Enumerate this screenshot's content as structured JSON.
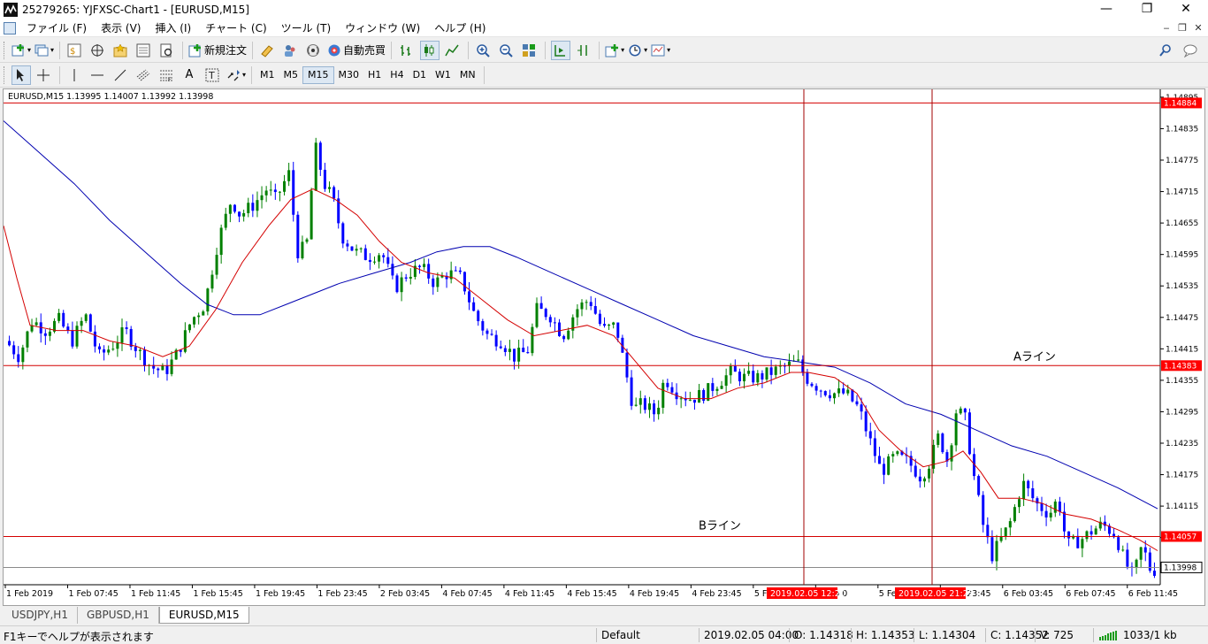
{
  "window": {
    "title": "25279265: YJFXSC-Chart1 - [EURUSD,M15]",
    "controls": [
      "—",
      "❐",
      "✕"
    ]
  },
  "menu": {
    "items": [
      "ファイル (F)",
      "表示 (V)",
      "挿入 (I)",
      "チャート (C)",
      "ツール (T)",
      "ウィンドウ (W)",
      "ヘルプ (H)"
    ]
  },
  "toolbar": {
    "new_order_label": "新規注文",
    "auto_trade_label": "自動売買"
  },
  "timeframes": [
    "M1",
    "M5",
    "M15",
    "M30",
    "H1",
    "H4",
    "D1",
    "W1",
    "MN"
  ],
  "active_timeframe": "M15",
  "tabs": [
    {
      "label": "USDJPY,H1",
      "active": false
    },
    {
      "label": "GBPUSD,H1",
      "active": false
    },
    {
      "label": "EURUSD,M15",
      "active": true
    }
  ],
  "status": {
    "help": "F1キーでヘルプが表示されます",
    "profile": "Default",
    "datetime": "2019.02.05 04:00",
    "open": "O: 1.14318",
    "high": "H: 1.14353",
    "low": "L: 1.14304",
    "close": "C: 1.14352",
    "volume": "V: 725",
    "traffic": "1033/1 kb"
  },
  "colors": {
    "bull": "#008000",
    "bear": "#0000ff",
    "ma_fast": "#d40000",
    "ma_slow": "#0000b0",
    "hline": "#d40000",
    "vline": "#a00000",
    "price_tag_bg": "#ff0000",
    "bid_tag_bg": "#ffffff"
  },
  "chart_data": {
    "type": "candlestick",
    "symbol_info": "EURUSD,M15  1.13995 1.14007 1.13992 1.13998",
    "ylim": [
      1.13965,
      1.1491
    ],
    "y_ticks": [
      "1.14895",
      "1.14835",
      "1.14775",
      "1.14715",
      "1.14655",
      "1.14595",
      "1.14535",
      "1.14475",
      "1.14415",
      "1.14355",
      "1.14295",
      "1.14235",
      "1.14175",
      "1.14115",
      "1.14055",
      "1.13995"
    ],
    "x_ticks": [
      "1 Feb 2019",
      "1 Feb 07:45",
      "1 Feb 11:45",
      "1 Feb 15:45",
      "1 Feb 19:45",
      "1 Feb 23:45",
      "2 Feb 03:45",
      "4 Feb 07:45",
      "4 Feb 11:45",
      "4 Feb 15:45",
      "4 Feb 19:45",
      "4 Feb 23:45",
      "5 Feb 03:45",
      "5 Feb 0",
      "5 Feb 15:45",
      "5 Feb 23:45",
      "6 Feb 03:45",
      "6 Feb 07:45",
      "6 Feb 11:45"
    ],
    "hlines": [
      {
        "price": 1.14884,
        "label": "1.14884"
      },
      {
        "price": 1.14383,
        "label": "1.14383",
        "text": "Aライン"
      },
      {
        "price": 1.14057,
        "label": "1.14057",
        "text": "Bライン"
      }
    ],
    "bid": {
      "price": 1.13998,
      "label": "1.13998"
    },
    "vlines": [
      {
        "label": "2019.02.05 12:20"
      },
      {
        "label": "2019.02.05 21:25"
      }
    ],
    "close_path": [
      [
        0,
        1.1443
      ],
      [
        15,
        1.144
      ],
      [
        30,
        1.1447
      ],
      [
        45,
        1.1445
      ],
      [
        60,
        1.1447
      ],
      [
        75,
        1.1443
      ],
      [
        90,
        1.1448
      ],
      [
        105,
        1.144
      ],
      [
        120,
        1.1442
      ],
      [
        135,
        1.1445
      ],
      [
        150,
        1.1441
      ],
      [
        165,
        1.1438
      ],
      [
        180,
        1.1437
      ],
      [
        195,
        1.1441
      ],
      [
        210,
        1.1447
      ],
      [
        225,
        1.145
      ],
      [
        240,
        1.1462
      ],
      [
        255,
        1.147
      ],
      [
        265,
        1.1467
      ],
      [
        280,
        1.1469
      ],
      [
        295,
        1.1472
      ],
      [
        305,
        1.147
      ],
      [
        320,
        1.1475
      ],
      [
        330,
        1.146
      ],
      [
        340,
        1.1461
      ],
      [
        350,
        1.148
      ],
      [
        360,
        1.1473
      ],
      [
        370,
        1.147
      ],
      [
        380,
        1.1463
      ],
      [
        395,
        1.146
      ],
      [
        410,
        1.1459
      ],
      [
        425,
        1.146
      ],
      [
        440,
        1.1453
      ],
      [
        455,
        1.1456
      ],
      [
        470,
        1.1457
      ],
      [
        485,
        1.1454
      ],
      [
        500,
        1.1456
      ],
      [
        515,
        1.1455
      ],
      [
        530,
        1.1448
      ],
      [
        545,
        1.1444
      ],
      [
        560,
        1.1443
      ],
      [
        575,
        1.144
      ],
      [
        590,
        1.1441
      ],
      [
        600,
        1.1449
      ],
      [
        615,
        1.1448
      ],
      [
        630,
        1.1444
      ],
      [
        645,
        1.1449
      ],
      [
        660,
        1.1451
      ],
      [
        675,
        1.1445
      ],
      [
        690,
        1.1446
      ],
      [
        700,
        1.1438
      ],
      [
        710,
        1.143
      ],
      [
        720,
        1.1431
      ],
      [
        735,
        1.1429
      ],
      [
        745,
        1.1436
      ],
      [
        760,
        1.1433
      ],
      [
        775,
        1.1432
      ],
      [
        790,
        1.1433
      ],
      [
        805,
        1.1435
      ],
      [
        820,
        1.1437
      ],
      [
        835,
        1.1436
      ],
      [
        850,
        1.1436
      ],
      [
        865,
        1.1437
      ],
      [
        880,
        1.1438
      ],
      [
        895,
        1.1439
      ],
      [
        905,
        1.1436
      ],
      [
        920,
        1.1434
      ],
      [
        935,
        1.1433
      ],
      [
        950,
        1.1433
      ],
      [
        965,
        1.143
      ],
      [
        975,
        1.1425
      ],
      [
        990,
        1.1418
      ],
      [
        1005,
        1.1421
      ],
      [
        1020,
        1.142
      ],
      [
        1035,
        1.1417
      ],
      [
        1045,
        1.142
      ],
      [
        1055,
        1.1425
      ],
      [
        1065,
        1.142
      ],
      [
        1075,
        1.143
      ],
      [
        1085,
        1.1428
      ],
      [
        1095,
        1.1417
      ],
      [
        1105,
        1.1408
      ],
      [
        1115,
        1.1402
      ],
      [
        1125,
        1.1405
      ],
      [
        1135,
        1.1408
      ],
      [
        1150,
        1.1416
      ],
      [
        1165,
        1.1412
      ],
      [
        1180,
        1.141
      ],
      [
        1190,
        1.1413
      ],
      [
        1200,
        1.1404
      ],
      [
        1215,
        1.1405
      ],
      [
        1230,
        1.1407
      ],
      [
        1240,
        1.1408
      ],
      [
        1255,
        1.1406
      ],
      [
        1265,
        1.1401
      ],
      [
        1275,
        1.1398
      ],
      [
        1285,
        1.1404
      ],
      [
        1295,
        1.1399
      ],
      [
        1305,
        1.13998
      ]
    ],
    "ma_fast": [
      [
        0,
        1.1465
      ],
      [
        15,
        1.1455
      ],
      [
        30,
        1.1446
      ],
      [
        60,
        1.1445
      ],
      [
        90,
        1.1445
      ],
      [
        120,
        1.1443
      ],
      [
        150,
        1.1442
      ],
      [
        180,
        1.144
      ],
      [
        210,
        1.1442
      ],
      [
        240,
        1.1449
      ],
      [
        270,
        1.1458
      ],
      [
        300,
        1.1465
      ],
      [
        325,
        1.147
      ],
      [
        350,
        1.1472
      ],
      [
        375,
        1.147
      ],
      [
        400,
        1.1467
      ],
      [
        425,
        1.1462
      ],
      [
        450,
        1.1458
      ],
      [
        480,
        1.1456
      ],
      [
        510,
        1.1455
      ],
      [
        540,
        1.1451
      ],
      [
        570,
        1.1447
      ],
      [
        600,
        1.1444
      ],
      [
        630,
        1.1445
      ],
      [
        660,
        1.1446
      ],
      [
        690,
        1.1444
      ],
      [
        710,
        1.144
      ],
      [
        740,
        1.1434
      ],
      [
        770,
        1.1432
      ],
      [
        800,
        1.1432
      ],
      [
        830,
        1.1434
      ],
      [
        860,
        1.1435
      ],
      [
        890,
        1.1437
      ],
      [
        910,
        1.1437
      ],
      [
        940,
        1.1436
      ],
      [
        965,
        1.1433
      ],
      [
        990,
        1.1426
      ],
      [
        1015,
        1.1422
      ],
      [
        1040,
        1.1419
      ],
      [
        1065,
        1.142
      ],
      [
        1085,
        1.1422
      ],
      [
        1105,
        1.1418
      ],
      [
        1125,
        1.1413
      ],
      [
        1150,
        1.1413
      ],
      [
        1175,
        1.1412
      ],
      [
        1200,
        1.141
      ],
      [
        1230,
        1.1409
      ],
      [
        1260,
        1.1407
      ],
      [
        1285,
        1.1405
      ],
      [
        1305,
        1.1403
      ]
    ],
    "ma_slow": [
      [
        0,
        1.1485
      ],
      [
        40,
        1.1479
      ],
      [
        80,
        1.1473
      ],
      [
        120,
        1.1466
      ],
      [
        160,
        1.146
      ],
      [
        200,
        1.1454
      ],
      [
        230,
        1.145
      ],
      [
        260,
        1.1448
      ],
      [
        290,
        1.1448
      ],
      [
        320,
        1.145
      ],
      [
        350,
        1.1452
      ],
      [
        380,
        1.1454
      ],
      [
        420,
        1.1456
      ],
      [
        460,
        1.1458
      ],
      [
        490,
        1.146
      ],
      [
        520,
        1.1461
      ],
      [
        550,
        1.1461
      ],
      [
        580,
        1.1459
      ],
      [
        620,
        1.1456
      ],
      [
        660,
        1.1453
      ],
      [
        700,
        1.145
      ],
      [
        740,
        1.1447
      ],
      [
        780,
        1.1444
      ],
      [
        820,
        1.1442
      ],
      [
        860,
        1.144
      ],
      [
        900,
        1.1439
      ],
      [
        940,
        1.1438
      ],
      [
        980,
        1.1435
      ],
      [
        1020,
        1.1431
      ],
      [
        1060,
        1.1429
      ],
      [
        1100,
        1.1426
      ],
      [
        1140,
        1.1423
      ],
      [
        1180,
        1.1421
      ],
      [
        1220,
        1.1418
      ],
      [
        1260,
        1.1415
      ],
      [
        1305,
        1.1411
      ]
    ]
  }
}
